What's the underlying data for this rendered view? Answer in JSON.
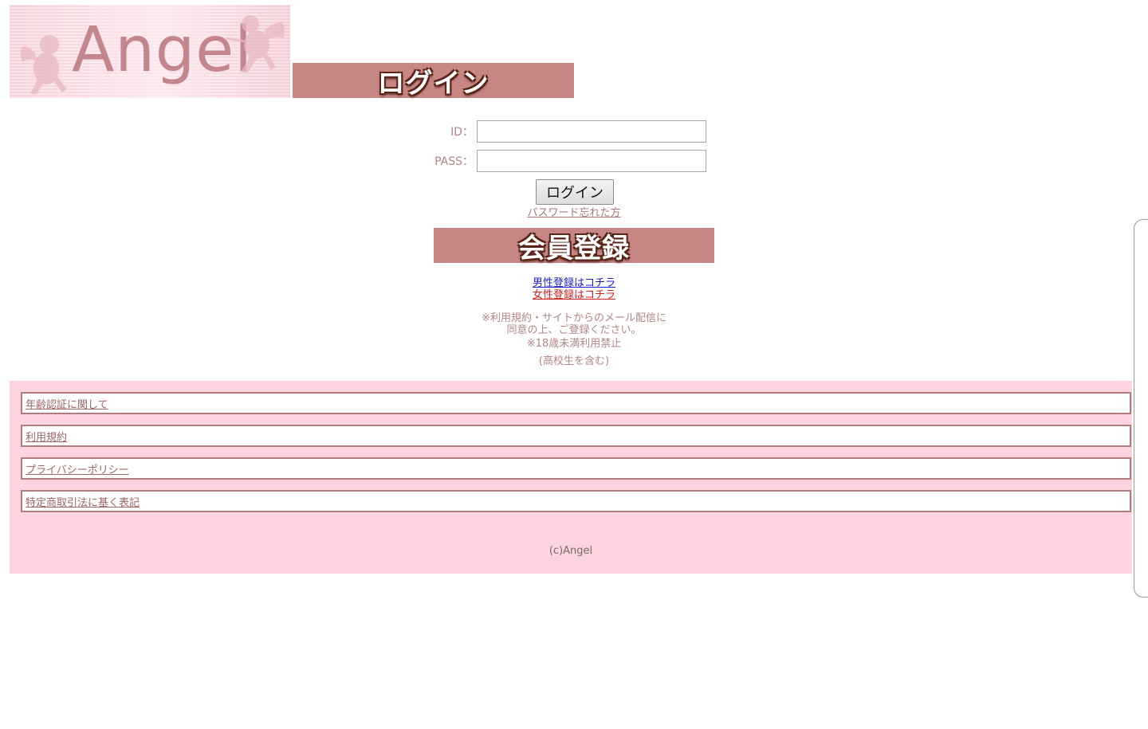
{
  "header": {
    "logo_text": "Angel",
    "login_banner": "ログイン"
  },
  "login_form": {
    "id_label": "ID：",
    "id_value": "",
    "pass_label": "PASS：",
    "pass_value": "",
    "submit_label": "ログイン",
    "forgot_link": "パスワード忘れた方"
  },
  "register": {
    "banner": "会員登録",
    "male_link": "男性登録はコチラ",
    "female_link": "女性登録はコチラ"
  },
  "notice": {
    "line1": "※利用規約・サイトからのメール配信に",
    "line2": "同意の上、ご登録ください。",
    "line3": "※18歳未満利用禁止",
    "line4": "(高校生を含む)"
  },
  "footer": {
    "links": [
      "年齢認証に関して",
      "利用規約",
      "プライバシーポリシー",
      "特定商取引法に基く表記"
    ],
    "copyright": "(c)Angel"
  },
  "colors": {
    "banner": "#c58684",
    "footer_bg": "#fdd3df",
    "label": "#b38585",
    "male_link": "#2020c8",
    "female_link": "#d01e1e"
  }
}
